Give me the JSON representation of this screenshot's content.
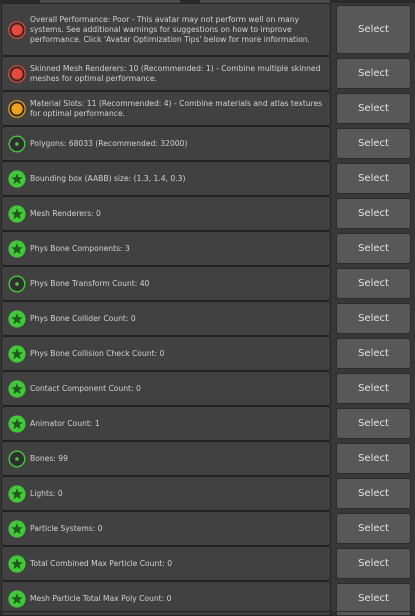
{
  "colors": {
    "status_poor": "#e8493c",
    "status_medium": "#f2a419",
    "status_good": "#41c93a",
    "status_excellent": "#41c93a"
  },
  "items": [
    {
      "status": "poor",
      "icon": "red-circle-icon",
      "text": "Overall Performance: Poor - This avatar may not perform well on many systems. See additional warnings for suggestions on how to improve performance. Click 'Avatar Optimization Tips' below for more information.",
      "button": "Select"
    },
    {
      "status": "poor",
      "icon": "red-circle-icon",
      "text": "Skinned Mesh Renderers: 10 (Recommended: 1) - Combine multiple skinned meshes for optimal performance.",
      "button": "Select"
    },
    {
      "status": "medium",
      "icon": "orange-circle-icon",
      "text": "Material Slots: 11 (Recommended: 4) - Combine materials and atlas textures for optimal performance.",
      "button": "Select"
    },
    {
      "status": "good",
      "icon": "green-ring-icon",
      "text": "Polygons: 68033 (Recommended: 32000)",
      "button": "Select"
    },
    {
      "status": "excellent",
      "icon": "green-star-icon",
      "text": "Bounding box (AABB) size: (1.3, 1.4, 0.3)",
      "button": "Select"
    },
    {
      "status": "excellent",
      "icon": "green-star-icon",
      "text": "Mesh Renderers: 0",
      "button": "Select"
    },
    {
      "status": "excellent",
      "icon": "green-star-icon",
      "text": "Phys Bone Components: 3",
      "button": "Select"
    },
    {
      "status": "good",
      "icon": "green-ring-icon",
      "text": "Phys Bone Transform Count: 40",
      "button": "Select"
    },
    {
      "status": "excellent",
      "icon": "green-star-icon",
      "text": "Phys Bone Collider Count: 0",
      "button": "Select"
    },
    {
      "status": "excellent",
      "icon": "green-star-icon",
      "text": "Phys Bone Collision Check Count: 0",
      "button": "Select"
    },
    {
      "status": "excellent",
      "icon": "green-star-icon",
      "text": "Contact Component Count: 0",
      "button": "Select"
    },
    {
      "status": "excellent",
      "icon": "green-star-icon",
      "text": "Animator Count: 1",
      "button": "Select"
    },
    {
      "status": "good",
      "icon": "green-ring-icon",
      "text": "Bones: 99",
      "button": "Select"
    },
    {
      "status": "excellent",
      "icon": "green-star-icon",
      "text": "Lights: 0",
      "button": "Select"
    },
    {
      "status": "excellent",
      "icon": "green-star-icon",
      "text": "Particle Systems: 0",
      "button": "Select"
    },
    {
      "status": "excellent",
      "icon": "green-star-icon",
      "text": "Total Combined Max Particle Count: 0",
      "button": "Select"
    },
    {
      "status": "excellent",
      "icon": "green-star-icon",
      "text": "Mesh Particle Total Max Poly Count: 0",
      "button": "Select"
    }
  ]
}
